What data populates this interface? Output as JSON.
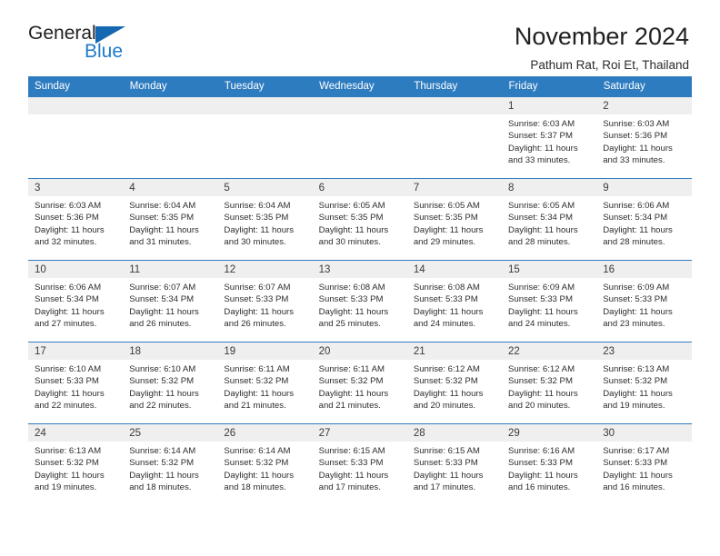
{
  "brand": {
    "name_top": "General",
    "name_bottom": "Blue",
    "accent_color": "#1667b2",
    "accent_color_text": "#1d7ac9"
  },
  "header": {
    "title": "November 2024",
    "subtitle": "Pathum Rat, Roi Et, Thailand"
  },
  "theme": {
    "header_row_bg": "#2e7cc0",
    "daynum_bg": "#efefef",
    "grid_line": "#2e7cc0"
  },
  "calendar": {
    "weekday_headers": [
      "Sunday",
      "Monday",
      "Tuesday",
      "Wednesday",
      "Thursday",
      "Friday",
      "Saturday"
    ],
    "labels": {
      "sunrise_prefix": "Sunrise:",
      "sunset_prefix": "Sunset:",
      "daylight_prefix": "Daylight:"
    },
    "weeks": [
      [
        {
          "day": "",
          "blank": true
        },
        {
          "day": "",
          "blank": true
        },
        {
          "day": "",
          "blank": true
        },
        {
          "day": "",
          "blank": true
        },
        {
          "day": "",
          "blank": true
        },
        {
          "day": "1",
          "sunrise": "Sunrise: 6:03 AM",
          "sunset": "Sunset: 5:37 PM",
          "daylight_line1": "Daylight: 11 hours",
          "daylight_line2": "and 33 minutes."
        },
        {
          "day": "2",
          "sunrise": "Sunrise: 6:03 AM",
          "sunset": "Sunset: 5:36 PM",
          "daylight_line1": "Daylight: 11 hours",
          "daylight_line2": "and 33 minutes."
        }
      ],
      [
        {
          "day": "3",
          "sunrise": "Sunrise: 6:03 AM",
          "sunset": "Sunset: 5:36 PM",
          "daylight_line1": "Daylight: 11 hours",
          "daylight_line2": "and 32 minutes."
        },
        {
          "day": "4",
          "sunrise": "Sunrise: 6:04 AM",
          "sunset": "Sunset: 5:35 PM",
          "daylight_line1": "Daylight: 11 hours",
          "daylight_line2": "and 31 minutes."
        },
        {
          "day": "5",
          "sunrise": "Sunrise: 6:04 AM",
          "sunset": "Sunset: 5:35 PM",
          "daylight_line1": "Daylight: 11 hours",
          "daylight_line2": "and 30 minutes."
        },
        {
          "day": "6",
          "sunrise": "Sunrise: 6:05 AM",
          "sunset": "Sunset: 5:35 PM",
          "daylight_line1": "Daylight: 11 hours",
          "daylight_line2": "and 30 minutes."
        },
        {
          "day": "7",
          "sunrise": "Sunrise: 6:05 AM",
          "sunset": "Sunset: 5:35 PM",
          "daylight_line1": "Daylight: 11 hours",
          "daylight_line2": "and 29 minutes."
        },
        {
          "day": "8",
          "sunrise": "Sunrise: 6:05 AM",
          "sunset": "Sunset: 5:34 PM",
          "daylight_line1": "Daylight: 11 hours",
          "daylight_line2": "and 28 minutes."
        },
        {
          "day": "9",
          "sunrise": "Sunrise: 6:06 AM",
          "sunset": "Sunset: 5:34 PM",
          "daylight_line1": "Daylight: 11 hours",
          "daylight_line2": "and 28 minutes."
        }
      ],
      [
        {
          "day": "10",
          "sunrise": "Sunrise: 6:06 AM",
          "sunset": "Sunset: 5:34 PM",
          "daylight_line1": "Daylight: 11 hours",
          "daylight_line2": "and 27 minutes."
        },
        {
          "day": "11",
          "sunrise": "Sunrise: 6:07 AM",
          "sunset": "Sunset: 5:34 PM",
          "daylight_line1": "Daylight: 11 hours",
          "daylight_line2": "and 26 minutes."
        },
        {
          "day": "12",
          "sunrise": "Sunrise: 6:07 AM",
          "sunset": "Sunset: 5:33 PM",
          "daylight_line1": "Daylight: 11 hours",
          "daylight_line2": "and 26 minutes."
        },
        {
          "day": "13",
          "sunrise": "Sunrise: 6:08 AM",
          "sunset": "Sunset: 5:33 PM",
          "daylight_line1": "Daylight: 11 hours",
          "daylight_line2": "and 25 minutes."
        },
        {
          "day": "14",
          "sunrise": "Sunrise: 6:08 AM",
          "sunset": "Sunset: 5:33 PM",
          "daylight_line1": "Daylight: 11 hours",
          "daylight_line2": "and 24 minutes."
        },
        {
          "day": "15",
          "sunrise": "Sunrise: 6:09 AM",
          "sunset": "Sunset: 5:33 PM",
          "daylight_line1": "Daylight: 11 hours",
          "daylight_line2": "and 24 minutes."
        },
        {
          "day": "16",
          "sunrise": "Sunrise: 6:09 AM",
          "sunset": "Sunset: 5:33 PM",
          "daylight_line1": "Daylight: 11 hours",
          "daylight_line2": "and 23 minutes."
        }
      ],
      [
        {
          "day": "17",
          "sunrise": "Sunrise: 6:10 AM",
          "sunset": "Sunset: 5:33 PM",
          "daylight_line1": "Daylight: 11 hours",
          "daylight_line2": "and 22 minutes."
        },
        {
          "day": "18",
          "sunrise": "Sunrise: 6:10 AM",
          "sunset": "Sunset: 5:32 PM",
          "daylight_line1": "Daylight: 11 hours",
          "daylight_line2": "and 22 minutes."
        },
        {
          "day": "19",
          "sunrise": "Sunrise: 6:11 AM",
          "sunset": "Sunset: 5:32 PM",
          "daylight_line1": "Daylight: 11 hours",
          "daylight_line2": "and 21 minutes."
        },
        {
          "day": "20",
          "sunrise": "Sunrise: 6:11 AM",
          "sunset": "Sunset: 5:32 PM",
          "daylight_line1": "Daylight: 11 hours",
          "daylight_line2": "and 21 minutes."
        },
        {
          "day": "21",
          "sunrise": "Sunrise: 6:12 AM",
          "sunset": "Sunset: 5:32 PM",
          "daylight_line1": "Daylight: 11 hours",
          "daylight_line2": "and 20 minutes."
        },
        {
          "day": "22",
          "sunrise": "Sunrise: 6:12 AM",
          "sunset": "Sunset: 5:32 PM",
          "daylight_line1": "Daylight: 11 hours",
          "daylight_line2": "and 20 minutes."
        },
        {
          "day": "23",
          "sunrise": "Sunrise: 6:13 AM",
          "sunset": "Sunset: 5:32 PM",
          "daylight_line1": "Daylight: 11 hours",
          "daylight_line2": "and 19 minutes."
        }
      ],
      [
        {
          "day": "24",
          "sunrise": "Sunrise: 6:13 AM",
          "sunset": "Sunset: 5:32 PM",
          "daylight_line1": "Daylight: 11 hours",
          "daylight_line2": "and 19 minutes."
        },
        {
          "day": "25",
          "sunrise": "Sunrise: 6:14 AM",
          "sunset": "Sunset: 5:32 PM",
          "daylight_line1": "Daylight: 11 hours",
          "daylight_line2": "and 18 minutes."
        },
        {
          "day": "26",
          "sunrise": "Sunrise: 6:14 AM",
          "sunset": "Sunset: 5:32 PM",
          "daylight_line1": "Daylight: 11 hours",
          "daylight_line2": "and 18 minutes."
        },
        {
          "day": "27",
          "sunrise": "Sunrise: 6:15 AM",
          "sunset": "Sunset: 5:33 PM",
          "daylight_line1": "Daylight: 11 hours",
          "daylight_line2": "and 17 minutes."
        },
        {
          "day": "28",
          "sunrise": "Sunrise: 6:15 AM",
          "sunset": "Sunset: 5:33 PM",
          "daylight_line1": "Daylight: 11 hours",
          "daylight_line2": "and 17 minutes."
        },
        {
          "day": "29",
          "sunrise": "Sunrise: 6:16 AM",
          "sunset": "Sunset: 5:33 PM",
          "daylight_line1": "Daylight: 11 hours",
          "daylight_line2": "and 16 minutes."
        },
        {
          "day": "30",
          "sunrise": "Sunrise: 6:17 AM",
          "sunset": "Sunset: 5:33 PM",
          "daylight_line1": "Daylight: 11 hours",
          "daylight_line2": "and 16 minutes."
        }
      ]
    ]
  }
}
